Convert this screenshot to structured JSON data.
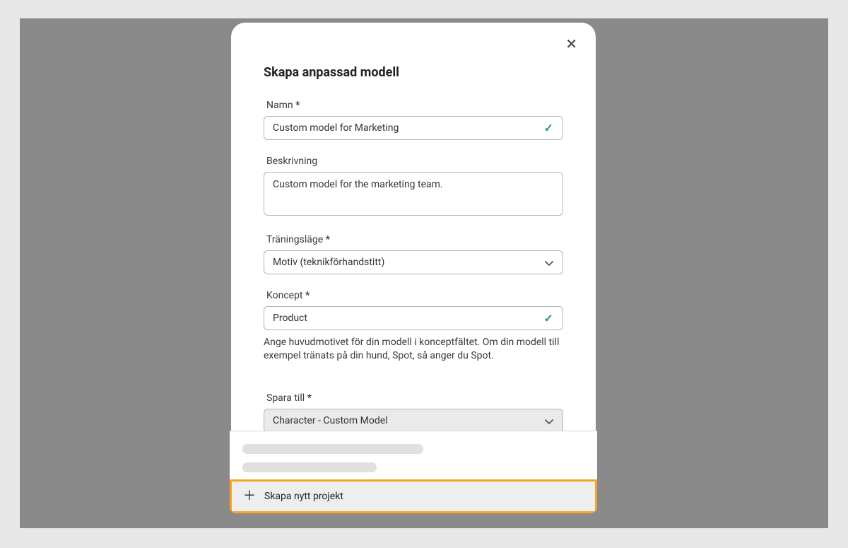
{
  "modal": {
    "title": "Skapa anpassad modell",
    "close_glyph": "✕"
  },
  "form": {
    "name": {
      "label": "Namn",
      "value": "Custom model for Marketing"
    },
    "description": {
      "label": "Beskrivning",
      "value": "Custom model for the marketing team."
    },
    "training_mode": {
      "label": "Träningsläge",
      "value": "Motiv (teknikförhandstitt)"
    },
    "concept": {
      "label": "Koncept",
      "value": "Product",
      "help": "Ange huvudmotivet för din modell i konceptfältet. Om din modell till exempel tränats på din hund, Spot, så anger du Spot."
    },
    "save_to": {
      "label": "Spara till",
      "value": "Character - Custom Model"
    },
    "create_project_label": "Skapa nytt projekt"
  },
  "icons": {
    "check": "✓"
  }
}
